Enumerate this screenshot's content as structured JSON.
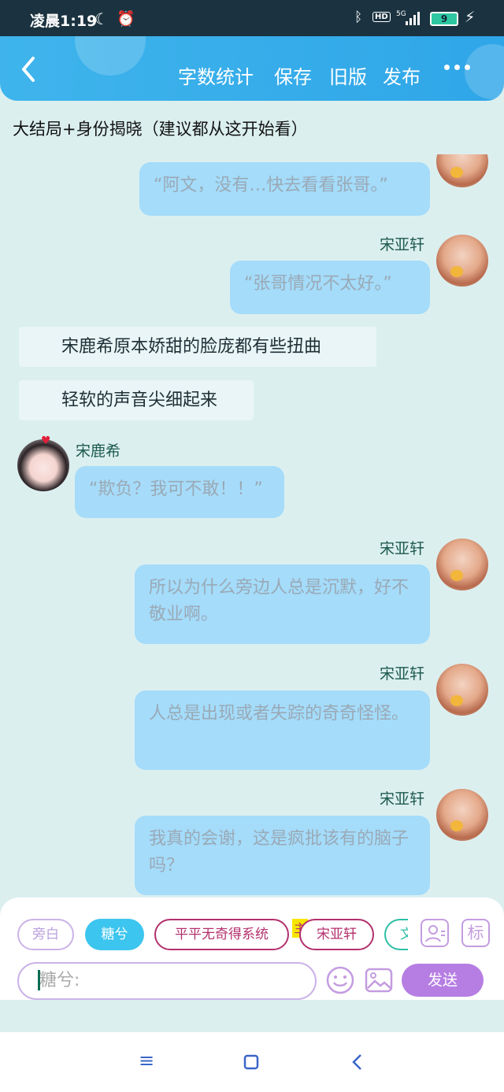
{
  "status_bar": {
    "time": "凌晨1:19",
    "hd_label": "HD",
    "network": "5G",
    "battery_level": "9"
  },
  "toolbar": {
    "back_label": "",
    "word_count_label": "字数统计",
    "save_label": "保存",
    "old_version_label": "旧版",
    "publish_label": "发布"
  },
  "chapter_title": "大结局+身份揭晓（建议都从这开始看）",
  "messages": [
    {
      "type": "dialog",
      "side": "right",
      "speaker": "",
      "text": "“阿文，没有…快去看看张哥。”"
    },
    {
      "type": "dialog",
      "side": "right",
      "speaker": "宋亚轩",
      "text": "“张哥情况不太好。”"
    },
    {
      "type": "narration",
      "text": "宋鹿希原本娇甜的脸庞都有些扭曲"
    },
    {
      "type": "narration",
      "text": "轻软的声音尖细起来"
    },
    {
      "type": "dialog",
      "side": "left",
      "speaker": "宋鹿希",
      "text": "“欺负？我可不敢！！”"
    },
    {
      "type": "dialog",
      "side": "right",
      "speaker": "宋亚轩",
      "text": "所以为什么旁边人总是沉默，好不敬业啊。"
    },
    {
      "type": "dialog",
      "side": "right",
      "speaker": "宋亚轩",
      "text": "人总是出现或者失踪的奇奇怪怪。"
    },
    {
      "type": "dialog",
      "side": "right",
      "speaker": "宋亚轩",
      "text": "我真的会谢，这是疯批该有的脑子吗？"
    }
  ],
  "character_chips": {
    "narration": "旁白",
    "current": "糖兮",
    "system": "平平无奇得系统",
    "main_tag": "主",
    "songyaxuan": "宋亚轩",
    "wen": "文"
  },
  "right_icons": {
    "tag_label": "标"
  },
  "input": {
    "placeholder": "糖兮:"
  },
  "send_label": "发送",
  "colors": {
    "accent": "#3fb4ec",
    "send": "#b67ee3",
    "chip_active": "#3cc5ee",
    "chip_system": "#b3306d"
  },
  "icons": [
    "back-icon",
    "more-icon",
    "profile-icon",
    "emoji-icon",
    "image-icon",
    "menu-nav-icon",
    "home-nav-icon",
    "back-nav-icon"
  ]
}
